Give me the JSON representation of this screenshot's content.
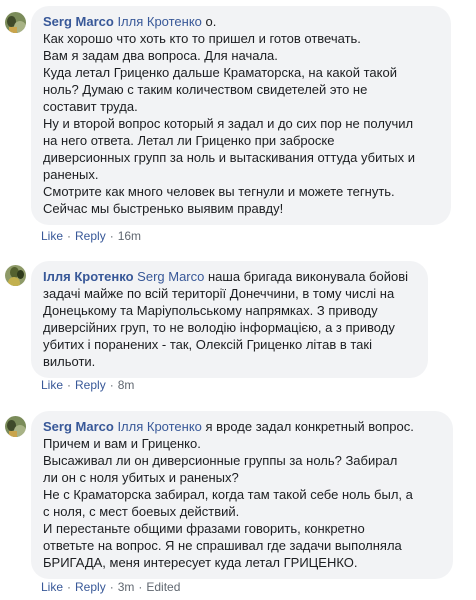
{
  "comments": [
    {
      "author": "Serg Marco",
      "mention": "Ілля Кротенко",
      "lines": [
        "о.",
        "Как хорошо что хоть кто то пришел и готов отвечать.",
        "Вам я задам два вопроса. Для начала.",
        "Куда летал Гриценко дальше Краматорска, на какой такой",
        "ноль? Думаю с таким количеством свидетелей это не",
        "составит труда.",
        "Ну и второй вопрос который я задал и до сих пор не получил",
        "на него ответа. Летал ли Гриценко при заброске",
        "диверсионных групп за ноль и вытаскивания оттуда убитых и",
        "раненых.",
        "Смотрите как много человек вы тегнули и можете тегнуть.",
        "Сейчас мы быстренько выявим правду!"
      ],
      "like": "Like",
      "reply": "Reply",
      "time": "16m",
      "edited": ""
    },
    {
      "author": "Ілля Кротенко",
      "mention": "Serg Marco",
      "lines": [
        "наша бригада виконувала бойові",
        "задачі майже по всій території Донеччини, в тому числі на",
        "Донецькому та Маріупольському напрямках. З приводу",
        "диверсійних груп, то не володію інформацією, а з приводу",
        "убитих і поранених - так, Олексій Гриценко літав в такі",
        "вильоти."
      ],
      "like": "Like",
      "reply": "Reply",
      "time": "8m",
      "edited": ""
    },
    {
      "author": "Serg Marco",
      "mention": "Ілля Кротенко",
      "lines": [
        "я вроде задал конкретный вопрос.",
        "Причем и вам и Гриценко.",
        "Высаживал ли он диверсионные группы за ноль? Забирал",
        "ли он с ноля убитых и раненых?",
        "Не с Краматорска забирал, когда там такой себе ноль был, а",
        "с ноля, с мест боевых действий.",
        "И перестаньте общими фразами говорить, конкретно",
        "ответьте на вопрос. Я не спрашивал где задачи выполняла",
        "БРИГАДА, меня интересует куда летал ГРИЦЕНКО."
      ],
      "like": "Like",
      "reply": "Reply",
      "time": "3m",
      "edited": "Edited"
    }
  ]
}
